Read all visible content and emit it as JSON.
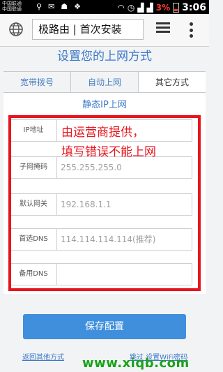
{
  "status_bar": {
    "carrier_1": "中国联通",
    "carrier_2": "中国联通",
    "battery_percent": "3%",
    "time": "3:06"
  },
  "browser": {
    "address": "极路由 | 首次安装"
  },
  "page": {
    "title": "设置您的上网方式",
    "tabs": [
      {
        "label": "宽带拨号"
      },
      {
        "label": "自动上网"
      },
      {
        "label": "其它方式"
      }
    ],
    "panel_title": "静态IP上网",
    "fields": [
      {
        "label": "IP地址",
        "value": ""
      },
      {
        "label": "子网掩码",
        "value": "255.255.255.0"
      },
      {
        "label": "默认网关",
        "value": "192.168.1.1"
      },
      {
        "label": "首选DNS",
        "value": "114.114.114.114(推荐)"
      },
      {
        "label": "备用DNS",
        "value": ""
      }
    ],
    "annotation": {
      "line_1": "由运营商提供，",
      "line_2": "填写错误不能上网"
    },
    "save_button": "保存配置",
    "back_link": "返回其他方式",
    "skip_link": "跳过 设置WiFi密码"
  },
  "watermark": "www.xiqb.com",
  "colors": {
    "accent": "#3a78c9",
    "button": "#3f8fdc",
    "annotation": "#e8141d",
    "watermark": "#1aa21a"
  }
}
